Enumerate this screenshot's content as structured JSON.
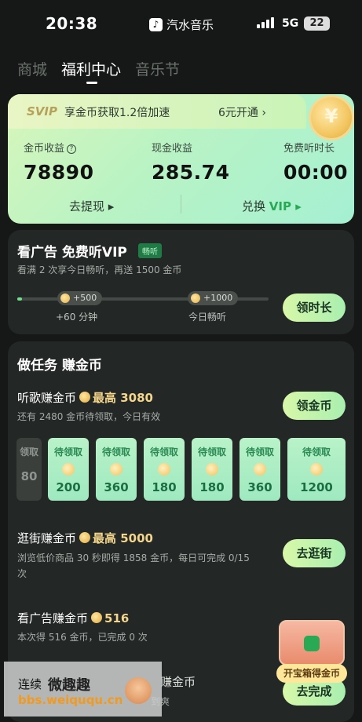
{
  "status_bar": {
    "time": "20:38",
    "app_name": "汽水音乐",
    "network": "5G",
    "battery": "22"
  },
  "tabs": [
    {
      "label": "商城"
    },
    {
      "label": "福利中心"
    },
    {
      "label": "音乐节"
    }
  ],
  "top_card": {
    "svip_badge": "SVIP",
    "boost_text": "享金币获取1.2倍加速",
    "open_text": "6元开通 ›",
    "stats": [
      {
        "label": "金币收益",
        "value": "78890"
      },
      {
        "label": "现金收益",
        "value": "285.74"
      },
      {
        "label": "免费听时长",
        "value": "00:00"
      }
    ],
    "withdraw_label": "去提现 ▸",
    "exchange_label": "兑换",
    "exchange_vip": "VIP ▸"
  },
  "ad_panel": {
    "title": "看广告 免费听VIP",
    "tag": "畅听",
    "subtitle": "看满 2 次享今日畅听，再送 1500 金币",
    "progress": 0.02,
    "nodes": [
      {
        "badge": "+500",
        "label": "+60 分钟"
      },
      {
        "badge": "+1000",
        "label": "今日畅听"
      }
    ],
    "button": "领时长"
  },
  "tasks_panel": {
    "heading": "做任务 赚金币",
    "music": {
      "title": "听歌赚金币",
      "highlight": "最高 3080",
      "subtitle": "还有 2480 金币待领取，今日有效",
      "button": "领金币",
      "faded_slot": {
        "t": "领取",
        "n": "80"
      },
      "slots": [
        {
          "t": "待领取",
          "n": "200"
        },
        {
          "t": "待领取",
          "n": "360"
        },
        {
          "t": "待领取",
          "n": "180"
        },
        {
          "t": "待领取",
          "n": "180"
        },
        {
          "t": "待领取",
          "n": "360"
        },
        {
          "t": "待领取",
          "n": "1200"
        }
      ]
    },
    "shop": {
      "title": "逛街赚金币",
      "highlight": "最高 5000",
      "subtitle_1": "浏览低价商品 30 秒即得 1858 金币，每日可完成 0/15",
      "subtitle_2": "次",
      "button": "去逛街"
    },
    "ads": {
      "title": "看广告赚金币",
      "highlight": "516",
      "subtitle": "本次得 516 金币，已完成 0 次"
    },
    "bottom": {
      "title_part": "连续",
      "title_tail": "赚金币",
      "sub_tail": "到爽",
      "button": "去完成"
    }
  },
  "chest_label": "开宝箱得金币",
  "watermark": {
    "line1": "微趣趣",
    "line2": "bbs.weiququ.cn"
  }
}
